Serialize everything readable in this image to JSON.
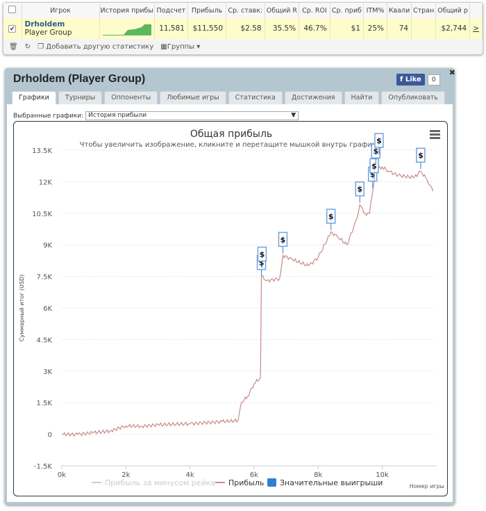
{
  "table": {
    "headers": [
      "Игрок",
      "История прибы",
      "Подсчет",
      "Прибыль",
      "Ср. ставк:",
      "Общий R",
      "Ср. ROI",
      "Ср. приб",
      "ITM%",
      "Квали",
      "Стран",
      "Общий р"
    ],
    "row": {
      "name": "Drholdem",
      "group": "Player Group",
      "values": [
        "11,581",
        "$11,550",
        "$2.58",
        "35.5%",
        "46.7%",
        "$1",
        "25%",
        "74",
        "",
        "$2,744"
      ],
      "more": ">"
    }
  },
  "toolbar": {
    "add_stat": "Добавить другую статистику",
    "groups": "Группы"
  },
  "panel": {
    "title": "Drholdem (Player Group)",
    "like": "Like",
    "like_count": "0",
    "tabs": [
      "Графики",
      "Турниры",
      "Оппоненты",
      "Любимые игры",
      "Статистика",
      "Достижения",
      "Найти",
      "Опубликовать"
    ],
    "select_label": "Выбранные графики:",
    "select_value": "История прибыли"
  },
  "chart_data": {
    "type": "line",
    "title": "Общая прибыль",
    "subtitle": "Чтобы увеличить изображение, кликните и перетащите мышкой внутрь графика.",
    "xlabel": "Номер игры",
    "ylabel": "Суммарный итог (USD)",
    "xlim": [
      0,
      11700
    ],
    "ylim": [
      -1500,
      13500
    ],
    "xticks": [
      "0k",
      "2k",
      "4k",
      "6k",
      "8k",
      "10k"
    ],
    "yticks": [
      "13.5K",
      "12K",
      "10.5K",
      "9K",
      "7.5K",
      "6K",
      "4.5K",
      "3K",
      "1.5K",
      "0",
      "-1.5K"
    ],
    "legend": [
      "Прибыль за минусом рейка",
      "Прибыль",
      "Значительные выигрыши"
    ],
    "colors": {
      "profit": "#c98a8a",
      "rake": "#cccccc",
      "wins": "#2f7ed8"
    },
    "series": [
      {
        "name": "Прибыль",
        "points": [
          [
            0,
            0
          ],
          [
            500,
            -10
          ],
          [
            1000,
            80
          ],
          [
            1500,
            150
          ],
          [
            2000,
            400
          ],
          [
            2500,
            380
          ],
          [
            3000,
            450
          ],
          [
            4000,
            500
          ],
          [
            5000,
            600
          ],
          [
            5500,
            650
          ],
          [
            5600,
            1500
          ],
          [
            5800,
            1800
          ],
          [
            6000,
            2400
          ],
          [
            6200,
            2700
          ],
          [
            6230,
            7500
          ],
          [
            6400,
            7300
          ],
          [
            6800,
            7400
          ],
          [
            6900,
            8500
          ],
          [
            7200,
            8300
          ],
          [
            7700,
            8000
          ],
          [
            8000,
            8400
          ],
          [
            8400,
            9600
          ],
          [
            8600,
            9400
          ],
          [
            8900,
            9000
          ],
          [
            9200,
            10200
          ],
          [
            9300,
            10900
          ],
          [
            9500,
            10400
          ],
          [
            9600,
            10500
          ],
          [
            9700,
            11500
          ],
          [
            9800,
            12600
          ],
          [
            10000,
            12700
          ],
          [
            10200,
            12500
          ],
          [
            10500,
            12300
          ],
          [
            11000,
            12200
          ],
          [
            11200,
            12500
          ],
          [
            11400,
            12100
          ],
          [
            11581,
            11550
          ]
        ]
      }
    ],
    "big_wins": [
      [
        6230,
        7500
      ],
      [
        6250,
        7900
      ],
      [
        6900,
        8600
      ],
      [
        8400,
        9700
      ],
      [
        9300,
        11000
      ],
      [
        9700,
        11700
      ],
      [
        9750,
        12100
      ],
      [
        9800,
        12800
      ],
      [
        9900,
        13300
      ],
      [
        11200,
        12600
      ]
    ],
    "marker": "$"
  }
}
